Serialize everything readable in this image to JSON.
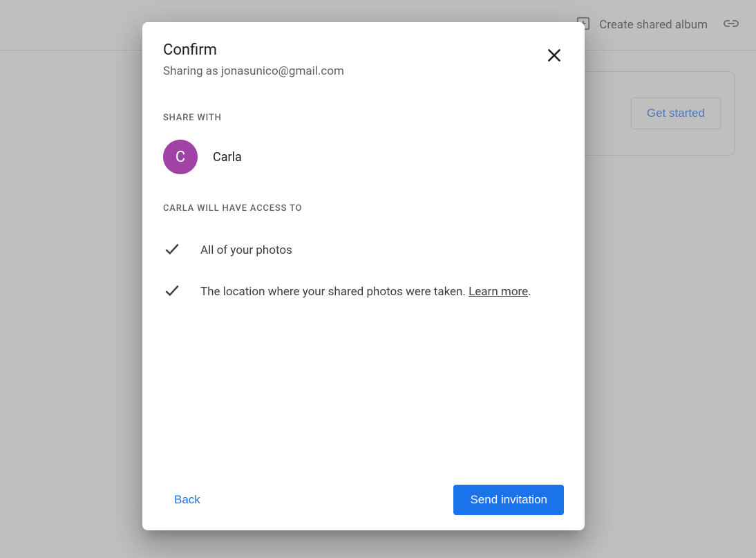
{
  "topbar": {
    "create_shared_album_label": "Create shared album"
  },
  "bg_card": {
    "get_started_label": "Get started"
  },
  "modal": {
    "title": "Confirm",
    "subtitle": "Sharing as jonasunico@gmail.com",
    "share_with_label": "SHARE WITH",
    "contact": {
      "initial": "C",
      "name": "Carla"
    },
    "access_header": "CARLA WILL HAVE ACCESS TO",
    "access_items": [
      {
        "text": "All of your photos"
      },
      {
        "text": "The location where your shared photos were taken. "
      }
    ],
    "learn_more_label": "Learn more",
    "period": ".",
    "back_label": "Back",
    "send_label": "Send invitation"
  }
}
